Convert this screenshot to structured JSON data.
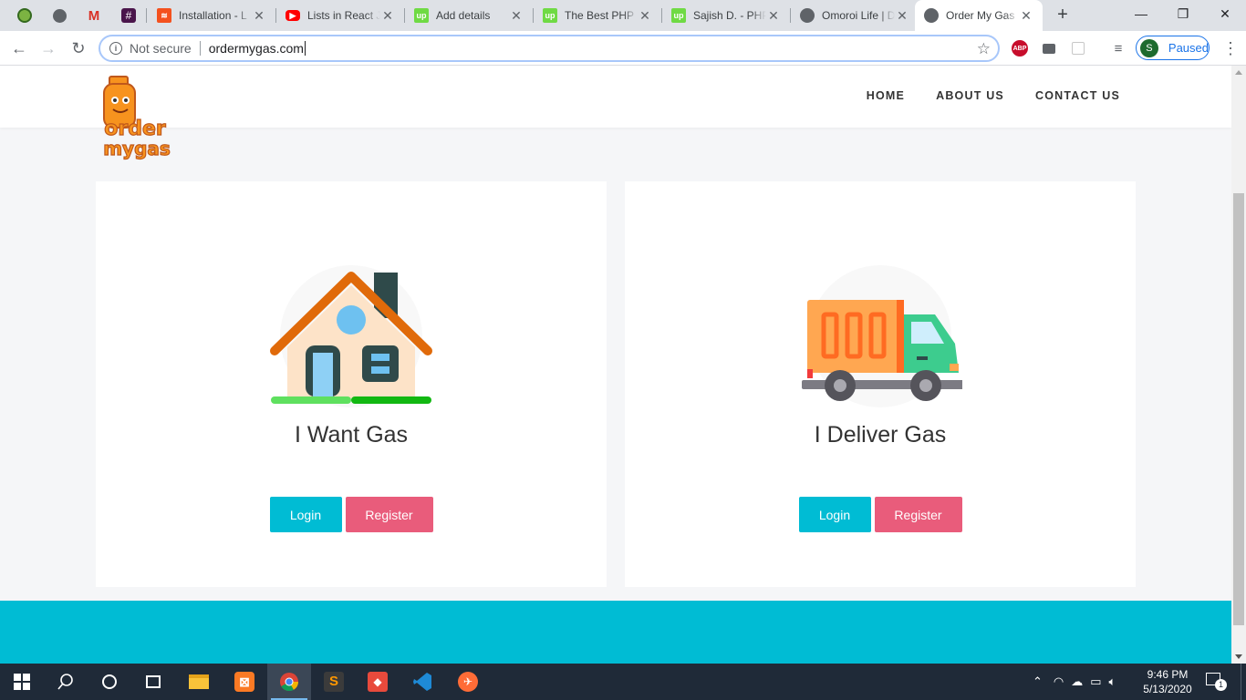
{
  "browser": {
    "tabs": [
      {
        "title": "Installation - L",
        "favicon": "laravel-icon"
      },
      {
        "title": "Lists in React J",
        "favicon": "youtube-icon"
      },
      {
        "title": "Add details",
        "favicon": "upwork-icon"
      },
      {
        "title": "The Best PHP",
        "favicon": "upwork-icon"
      },
      {
        "title": "Sajish D. - PHP",
        "favicon": "upwork-icon"
      },
      {
        "title": "Omoroi Life | D",
        "favicon": "globe-icon"
      },
      {
        "title": "Order My Gas",
        "favicon": "globe-icon"
      }
    ],
    "security_label": "Not secure",
    "url": "ordermygas.com",
    "profile_initial": "S",
    "profile_status": "Paused",
    "abp_label": "ABP"
  },
  "site": {
    "logo_alt": "order my gas",
    "nav": [
      {
        "label": "HOME"
      },
      {
        "label": "ABOUT US"
      },
      {
        "label": "CONTACT US"
      }
    ],
    "cards": [
      {
        "title": "I Want Gas",
        "login_label": "Login",
        "register_label": "Register"
      },
      {
        "title": "I Deliver Gas",
        "login_label": "Login",
        "register_label": "Register"
      }
    ]
  },
  "taskbar": {
    "time": "9:46 PM",
    "date": "5/13/2020",
    "notification_count": "1"
  },
  "colors": {
    "accent_cyan": "#00bcd4",
    "register_pink": "#e95c7b"
  }
}
